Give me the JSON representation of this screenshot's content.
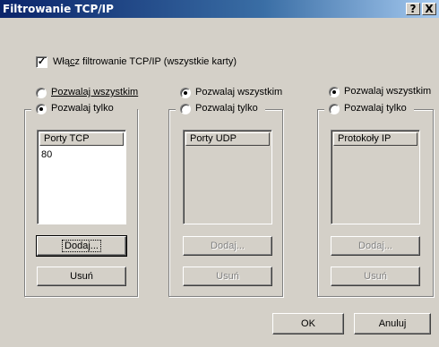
{
  "window": {
    "title": "Filtrowanie TCP/IP",
    "help_label": "?",
    "close_label": "X"
  },
  "enable_filter": {
    "label_pre": "Włą",
    "label_ul": "c",
    "label_post": "z filtrowanie TCP/IP (wszystkie karty)",
    "checked": true
  },
  "columns": {
    "tcp": {
      "permit_all": "Pozwalaj wszystkim",
      "permit_only": "Pozwalaj tylko",
      "selected": "permit_only",
      "list_header": "Porty TCP",
      "items": [
        "80"
      ],
      "add_label": "Dodaj...",
      "remove_label": "Usuń",
      "enabled": true
    },
    "udp": {
      "permit_all": "Pozwalaj wszystkim",
      "permit_only": "Pozwalaj tylko",
      "selected": "permit_all",
      "list_header": "Porty UDP",
      "items": [],
      "add_label": "Dodaj...",
      "remove_label": "Usuń",
      "enabled": false
    },
    "ip": {
      "permit_all": "Pozwalaj wszystkim",
      "permit_only": "Pozwalaj tylko",
      "selected": "permit_all",
      "list_header": "Protokoły IP",
      "items": [],
      "add_label": "Dodaj...",
      "remove_label": "Usuń",
      "enabled": false
    }
  },
  "footer": {
    "ok_label": "OK",
    "cancel_label": "Anuluj"
  }
}
